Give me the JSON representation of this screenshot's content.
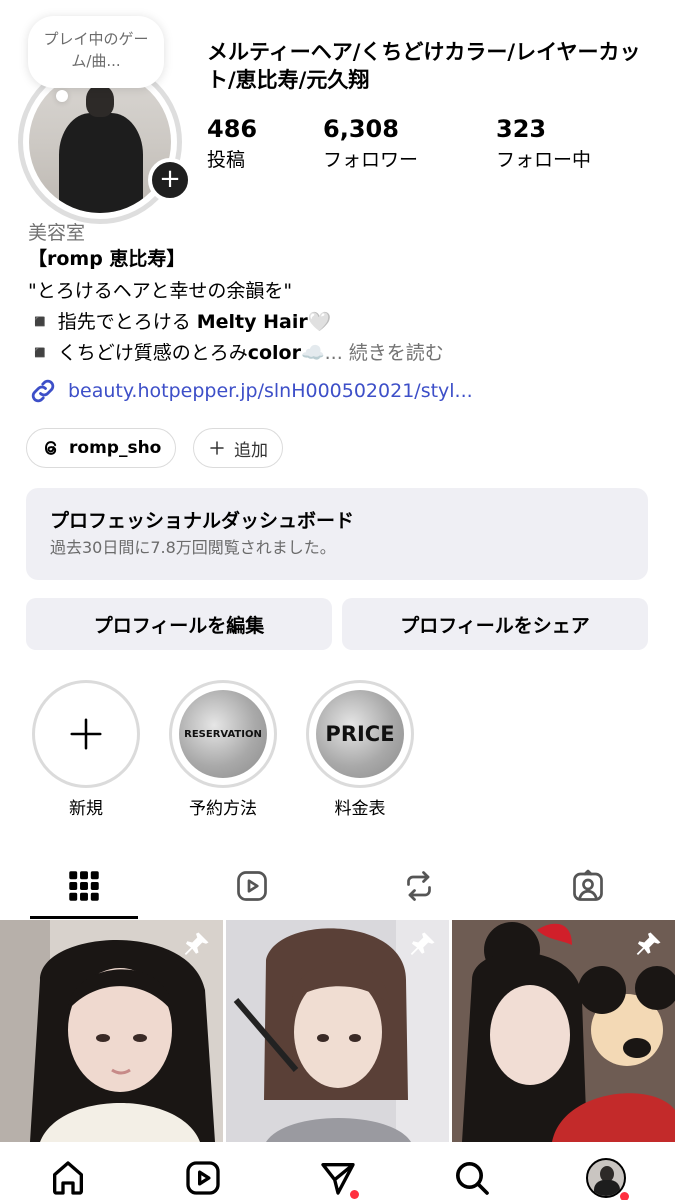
{
  "note": {
    "text": "プレイ中のゲーム/曲..."
  },
  "profile": {
    "name": "メルティーヘア/くちどけカラー/レイヤーカット/恵比寿/元久翔",
    "stats": [
      {
        "value": "486",
        "label": "投稿"
      },
      {
        "value": "6,308",
        "label": "フォロワー"
      },
      {
        "value": "323",
        "label": "フォロー中"
      }
    ],
    "category": "美容室",
    "bio_shop": "【romp 恵比寿】",
    "bio_quote": "\"とろけるヘアと幸せの余韻を\"",
    "bio_line3_pre": "◾️ 指先でとろける ",
    "bio_line3_bold": "Melty Hair",
    "bio_line3_emoji": "🤍",
    "bio_line4_pre": "◾️ くちどけ質感のとろみ",
    "bio_line4_bold": "color",
    "bio_line4_emoji": "☁️",
    "bio_more": "... 続きを読む",
    "link": "beauty.hotpepper.jp/slnH000502021/styl..."
  },
  "chips": {
    "threads": "romp_sho",
    "add": "追加"
  },
  "dashboard": {
    "title": "プロフェッショナルダッシュボード",
    "subtitle": "過去30日間に7.8万回閲覧されました。"
  },
  "actions": {
    "edit": "プロフィールを編集",
    "share": "プロフィールをシェア"
  },
  "highlights": [
    {
      "label": "新規",
      "inner": ""
    },
    {
      "label": "予約方法",
      "inner": "RESERVATION"
    },
    {
      "label": "料金表",
      "inner": "PRICE"
    }
  ],
  "colors": {
    "link": "#3d4fc8",
    "notification": "#ff3040",
    "button_bg": "#efeff4"
  }
}
